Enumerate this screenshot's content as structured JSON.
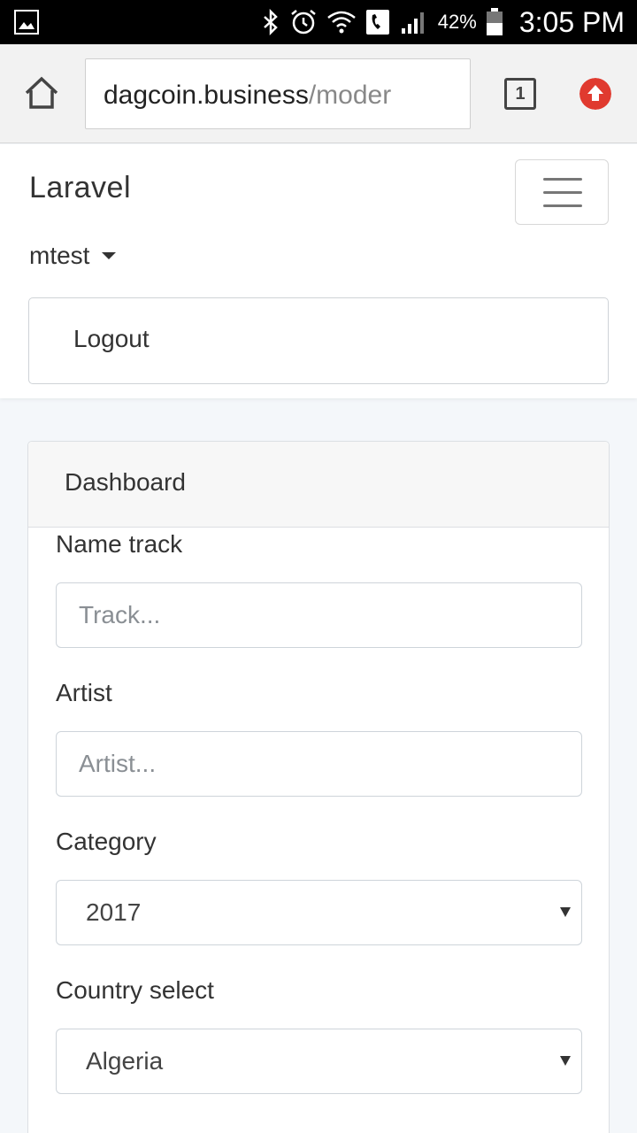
{
  "status_bar": {
    "battery": "42%",
    "time": "3:05 PM",
    "icons": [
      "gallery-icon",
      "bluetooth-icon",
      "alarm-icon",
      "wifi-icon",
      "call-icon",
      "signal-icon",
      "battery-icon"
    ]
  },
  "browser": {
    "url_host": "dagcoin.business",
    "url_path": "/moder",
    "tab_count": "1",
    "icons": [
      "home-icon",
      "tabs-icon",
      "upload-icon"
    ]
  },
  "navbar": {
    "brand": "Laravel",
    "user": "mtest",
    "logout_label": "Logout"
  },
  "card": {
    "header": "Dashboard",
    "fields": [
      {
        "label": "Name track",
        "placeholder": "Track..."
      },
      {
        "label": "Artist",
        "placeholder": "Artist..."
      },
      {
        "label": "Category",
        "selected": "2017"
      },
      {
        "label": "Country select",
        "selected": "Algeria"
      }
    ]
  },
  "colors": {
    "accent": "#e03a2f",
    "page_bg": "#f4f7fa",
    "border": "#ced4da"
  }
}
